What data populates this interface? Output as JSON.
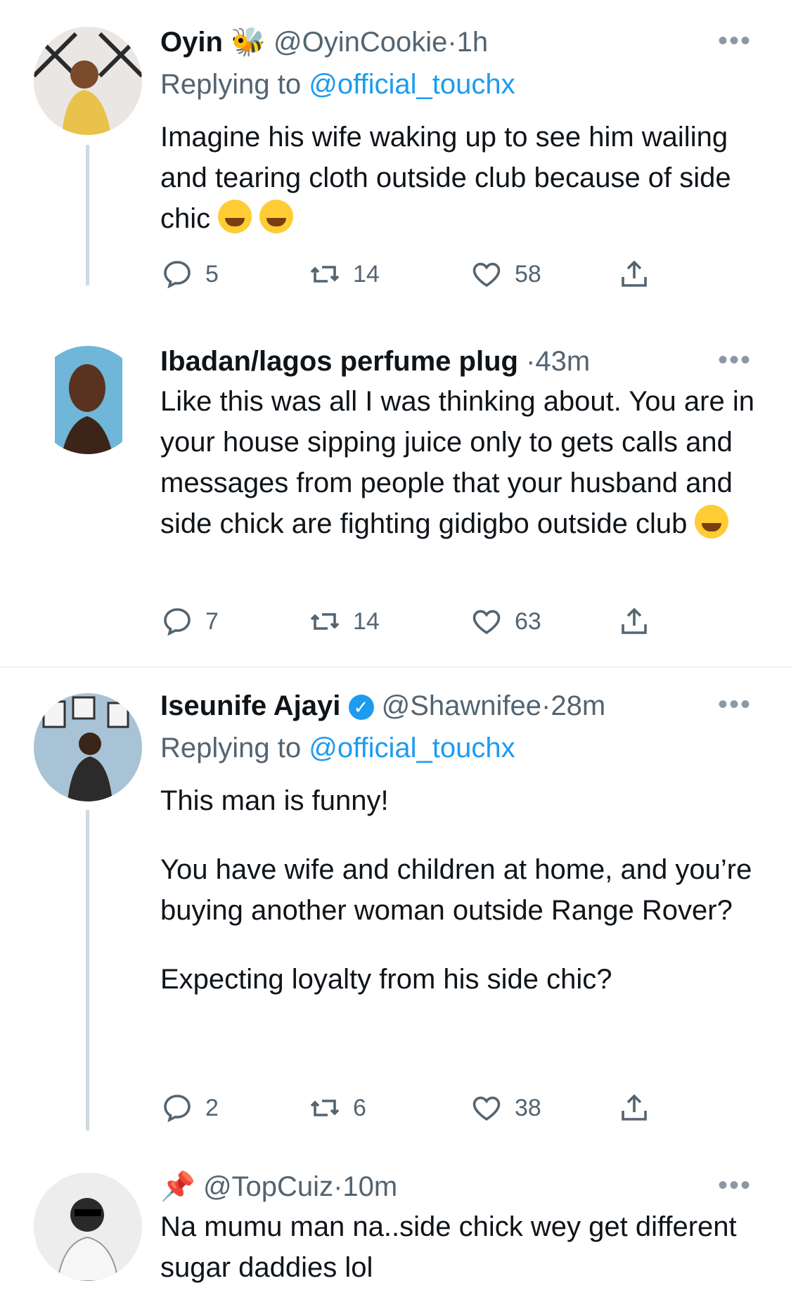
{
  "tweets": [
    {
      "name": "Oyin",
      "name_emoji": "🐝",
      "handle": "@OyinCookie",
      "dot": "·",
      "time": "1h",
      "replying_prefix": "Replying to",
      "replying_to": "@official_touchx",
      "text": "Imagine his wife waking up to see him wailing and tearing cloth outside club because of side chic",
      "emojis": [
        "face-with-tears-of-joy",
        "rolling-on-floor-laughing"
      ],
      "replies": "5",
      "retweets": "14",
      "likes": "58"
    },
    {
      "name": "Ibadan/lagos perfume plug",
      "dot": "·",
      "time": "43m",
      "text": "Like this was all I was thinking about. You are in your house sipping juice only to gets calls and messages from people that your husband and side chick are fighting gidigbo outside club",
      "emojis": [
        "loudly-crying-face"
      ],
      "replies": "7",
      "retweets": "14",
      "likes": "63"
    },
    {
      "name": "Iseunife Ajayi",
      "verified": "✓",
      "handle": "@Shawnifee",
      "dot": "·",
      "time": "28m",
      "replying_prefix": "Replying to",
      "replying_to": "@official_touchx",
      "text_lines": [
        "This man is funny!",
        "You have wife and children at home, and you’re buying another woman outside Range Rover?",
        "Expecting loyalty from his side chic?"
      ],
      "replies": "2",
      "retweets": "6",
      "likes": "38"
    },
    {
      "name_emoji": "📌",
      "handle": "@TopCuiz",
      "dot": "·",
      "time": "10m",
      "text": "Na mumu man na..side chick wey get different sugar daddies lol"
    }
  ],
  "more_label": "•••",
  "icons": {
    "reply": "reply-icon",
    "retweet": "retweet-icon",
    "like": "heart-icon",
    "share": "share-icon"
  },
  "colors": {
    "link": "#1d9bf0",
    "secondary_text": "#536471",
    "thread_line": "#cfd9de"
  }
}
